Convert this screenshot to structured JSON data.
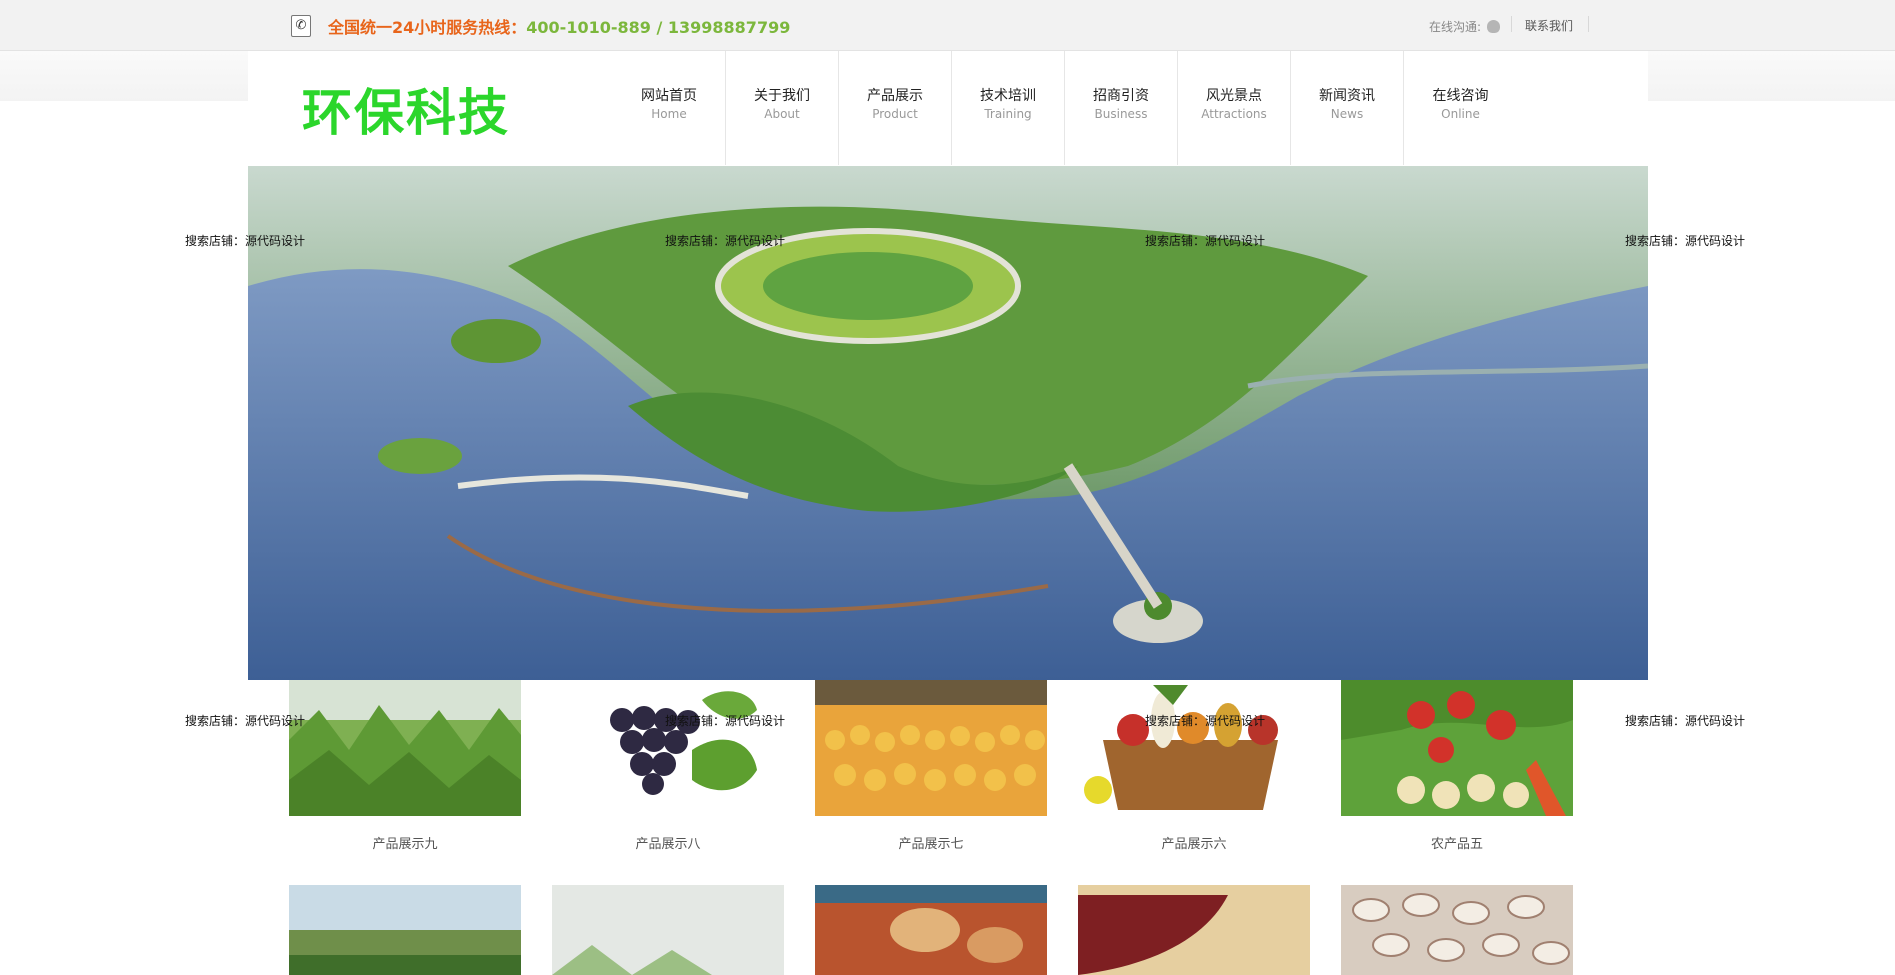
{
  "topbar": {
    "hotline_label": "全国统一24小时服务热线：",
    "hotline_numbers": "400-1010-889  / 13998887799",
    "online_chat_label": "在线沟通:",
    "contact_link": "联系我们",
    "phone_icon": "phone-icon",
    "chat_icon": "qq-penguin-icon"
  },
  "logo": {
    "text": "环保科技"
  },
  "nav": {
    "items": [
      {
        "cn": "网站首页",
        "en": "Home"
      },
      {
        "cn": "关于我们",
        "en": "About"
      },
      {
        "cn": "产品展示",
        "en": "Product"
      },
      {
        "cn": "技术培训",
        "en": "Training"
      },
      {
        "cn": "招商引资",
        "en": "Business"
      },
      {
        "cn": "风光景点",
        "en": "Attractions"
      },
      {
        "cn": "新闻资讯",
        "en": "News"
      },
      {
        "cn": "在线咨询",
        "en": "Online"
      }
    ]
  },
  "products": {
    "row1": [
      {
        "caption": "产品展示九"
      },
      {
        "caption": "产品展示八"
      },
      {
        "caption": "产品展示七"
      },
      {
        "caption": "产品展示六"
      },
      {
        "caption": "农产品五"
      }
    ]
  },
  "watermark": {
    "text": "搜索店铺：源代码设计"
  },
  "colors": {
    "hotline_label": "#e8651b",
    "hotline_number": "#7cb73c",
    "logo": "#2bd62b",
    "topbar_bg": "#f2f2f2"
  }
}
